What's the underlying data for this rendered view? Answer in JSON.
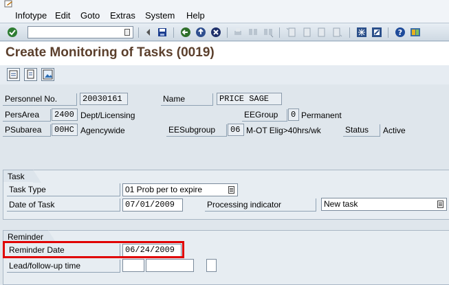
{
  "menu": {
    "items": [
      "Infotype",
      "Edit",
      "Goto",
      "Extras",
      "System",
      "Help"
    ]
  },
  "toolbar": {
    "command_value": "",
    "icons": [
      "enter-icon",
      "save-icon",
      "back-icon",
      "exit-icon",
      "cancel-icon",
      "print-icon",
      "find-icon",
      "find-next-icon",
      "first-page-icon",
      "previous-page-icon",
      "next-page-icon",
      "last-page-icon",
      "new-session-icon",
      "shortcut-icon",
      "help-icon",
      "layout-icon"
    ]
  },
  "page": {
    "title": "Create Monitoring of Tasks (0019)"
  },
  "header": {
    "personnel_no_label": "Personnel No.",
    "personnel_no": "20030161",
    "name_label": "Name",
    "name": "PRICE SAGE",
    "persarea_label": "PersArea",
    "persarea_code": "2400",
    "persarea_text": "Dept/Licensing",
    "eegroup_label": "EEGroup",
    "eegroup_code": "0",
    "eegroup_text": "Permanent",
    "psubarea_label": "PSubarea",
    "psubarea_code": "00HC",
    "psubarea_text": "Agencywide",
    "eesubgroup_label": "EESubgroup",
    "eesubgroup_code": "06",
    "eesubgroup_text": "M-OT Elig>40hrs/wk",
    "status_label": "Status",
    "status_value": "Active"
  },
  "task": {
    "group_label": "Task",
    "task_type_label": "Task Type",
    "task_type_value": "01 Prob per to expire",
    "date_label": "Date of Task",
    "date_value": "07/01/2009",
    "processing_label": "Processing indicator",
    "processing_value": "New task"
  },
  "reminder": {
    "group_label": "Reminder",
    "date_label": "Reminder Date",
    "date_value": "06/24/2009",
    "lead_label": "Lead/follow-up time",
    "lead_value": "",
    "lead_unit": "",
    "lead_sign": ""
  },
  "colors": {
    "title": "#5b3f2c",
    "highlight": "#e00000"
  }
}
